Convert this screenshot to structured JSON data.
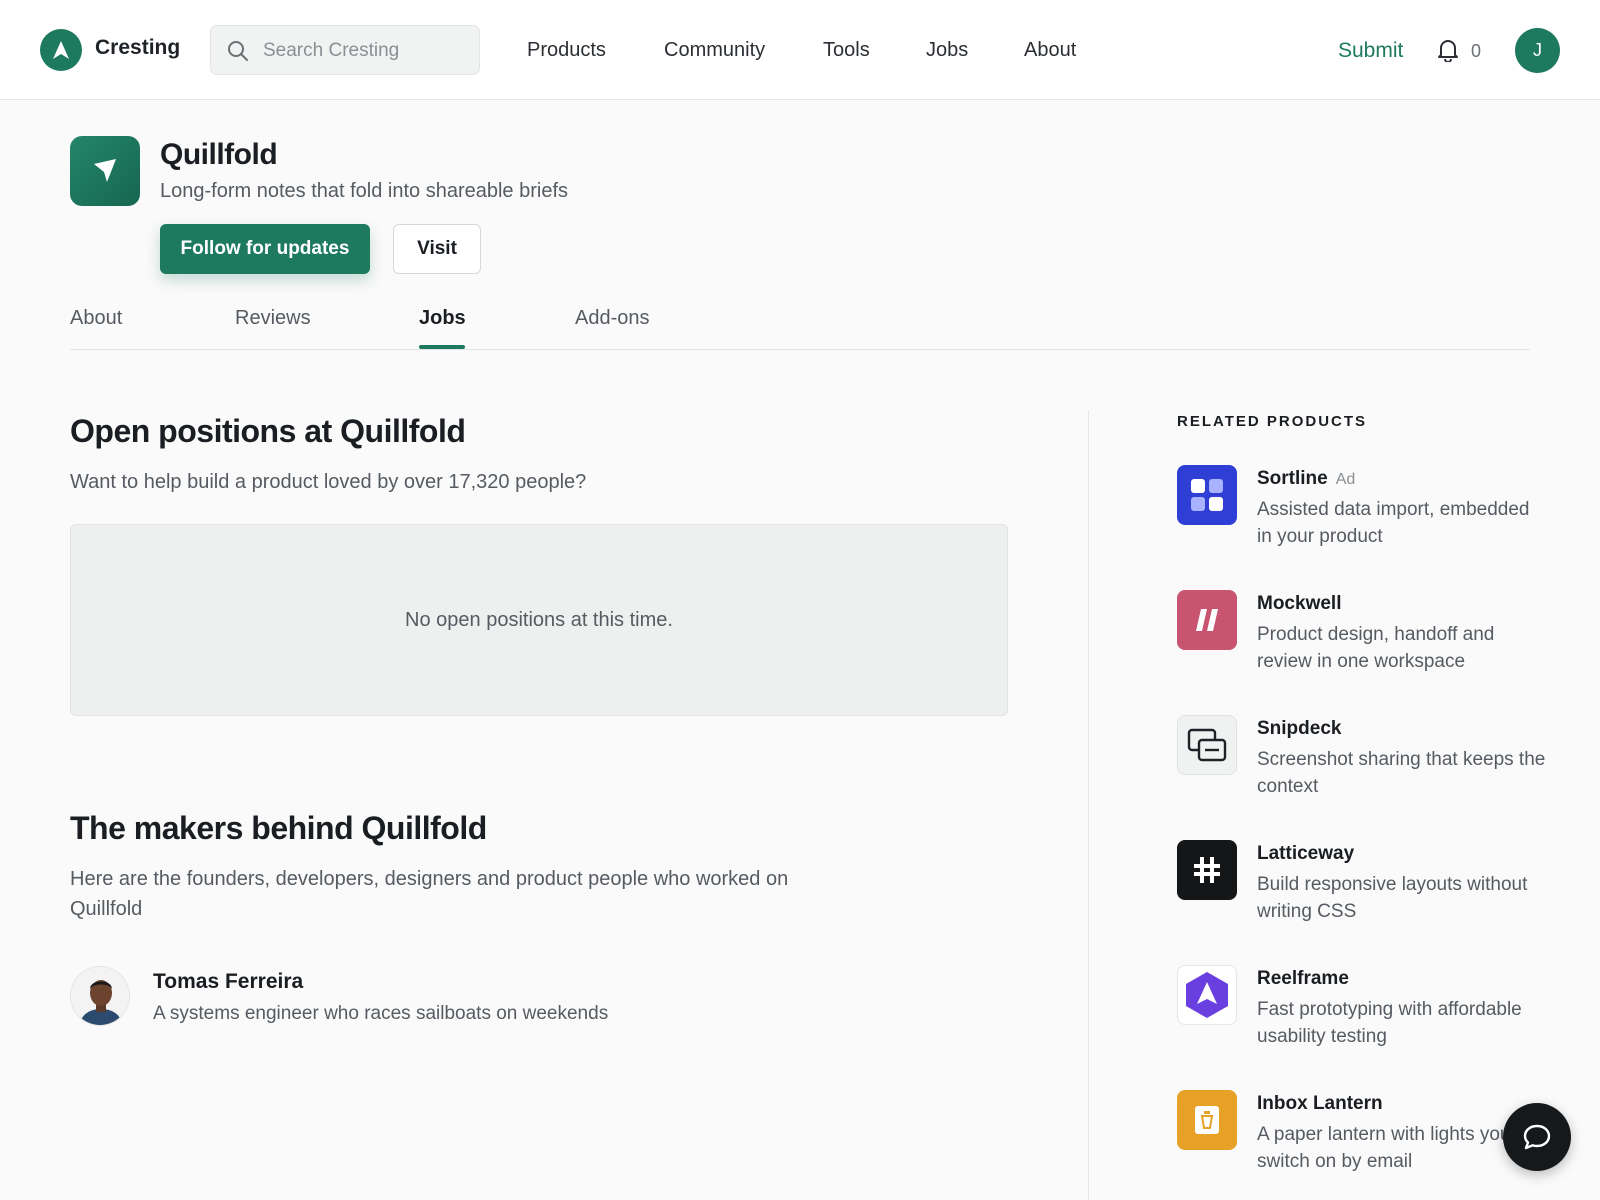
{
  "header": {
    "logo_text": "Cresting",
    "search_placeholder": "Search Cresting",
    "nav": [
      "Products",
      "Community",
      "Tools",
      "Jobs",
      "About"
    ],
    "submit_label": "Submit",
    "notification_count": "0",
    "user_initial": "J"
  },
  "product": {
    "name": "Quillfold",
    "tagline": "Long-form notes that fold into shareable briefs",
    "follow_label": "Follow for updates",
    "visit_label": "Visit"
  },
  "tabs": [
    {
      "label": "About"
    },
    {
      "label": "Reviews"
    },
    {
      "label": "Jobs",
      "active": true
    },
    {
      "label": "Add-ons"
    }
  ],
  "jobs": {
    "title": "Open positions at Quillfold",
    "subtitle": "Want to help build a product loved by over 17,320 people?",
    "empty_message": "No open positions at this time."
  },
  "makers": {
    "title": "The makers behind Quillfold",
    "subtitle": "Here are the founders, developers, designers and product people who worked on Quillfold",
    "people": [
      {
        "name": "Tomas Ferreira",
        "bio": "A systems engineer who races sailboats on weekends"
      }
    ]
  },
  "related": {
    "title": "RELATED PRODUCTS",
    "items": [
      {
        "name": "Sortline",
        "ad": "Ad",
        "desc": "Assisted data import, embedded in your product",
        "icon": "grid-icon",
        "color": "#2f3fd6"
      },
      {
        "name": "Mockwell",
        "desc": "Product design, handoff and review in one workspace",
        "icon": "slash-icon",
        "color": "#c9546f"
      },
      {
        "name": "Snipdeck",
        "desc": "Screenshot sharing that keeps the context",
        "icon": "screens-icon",
        "color": "#f0f1f1"
      },
      {
        "name": "Latticeway",
        "desc": "Build responsive layouts without writing CSS",
        "icon": "hash-icon",
        "color": "#141618"
      },
      {
        "name": "Reelframe",
        "desc": "Fast prototyping with affordable usability testing",
        "icon": "hexagon-icon",
        "color": "#6a3fe0"
      },
      {
        "name": "Inbox Lantern",
        "desc": "A paper lantern with lights you switch on by email",
        "icon": "lantern-icon",
        "color": "#e7a126"
      }
    ]
  },
  "colors": {
    "brand": "#1e7a5f",
    "text": "#1a1d21",
    "muted": "#555b61"
  }
}
